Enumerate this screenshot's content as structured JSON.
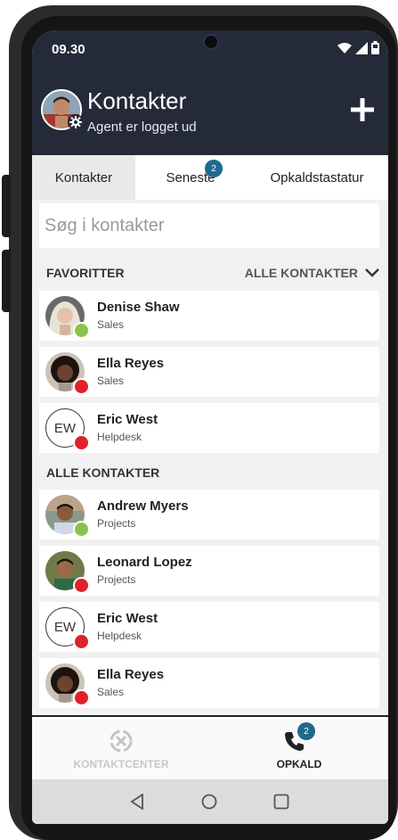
{
  "statusbar": {
    "time": "09.30"
  },
  "header": {
    "title": "Kontakter",
    "subtitle": "Agent er logget ud"
  },
  "tabs": [
    {
      "label": "Kontakter",
      "active": true
    },
    {
      "label": "Seneste",
      "badge": "2"
    },
    {
      "label": "Opkaldstastatur"
    }
  ],
  "search": {
    "placeholder": "Søg i kontakter"
  },
  "favorites": {
    "title": "FAVORITTER",
    "filter_label": "ALLE KONTAKTER",
    "items": [
      {
        "name": "Denise Shaw",
        "dept": "Sales",
        "status": "available",
        "avatar": "photo"
      },
      {
        "name": "Ella Reyes",
        "dept": "Sales",
        "status": "busy",
        "avatar": "photo"
      },
      {
        "name": "Eric West",
        "dept": "Helpdesk",
        "status": "busy",
        "avatar": "initials",
        "initials": "EW"
      }
    ]
  },
  "all_contacts": {
    "title": "ALLE KONTAKTER",
    "items": [
      {
        "name": "Andrew Myers",
        "dept": "Projects",
        "status": "available",
        "avatar": "photo"
      },
      {
        "name": "Leonard Lopez",
        "dept": "Projects",
        "status": "busy",
        "avatar": "photo"
      },
      {
        "name": "Eric West",
        "dept": "Helpdesk",
        "status": "busy",
        "avatar": "initials",
        "initials": "EW"
      },
      {
        "name": "Ella Reyes",
        "dept": "Sales",
        "status": "busy",
        "avatar": "photo"
      }
    ]
  },
  "bottom_nav": {
    "contact_center_label": "KONTAKTCENTER",
    "calls_label": "OPKALD",
    "calls_badge": "2"
  },
  "colors": {
    "header_bg": "#242a38",
    "badge": "#1e6a8f",
    "available": "#8bc34a",
    "busy": "#e0202a"
  },
  "icons": [
    "settings-gear-icon",
    "add-icon",
    "chevron-down-icon",
    "contact-center-icon",
    "phone-icon",
    "back-icon",
    "home-icon",
    "recents-icon",
    "wifi-icon",
    "signal-icon",
    "battery-icon"
  ]
}
